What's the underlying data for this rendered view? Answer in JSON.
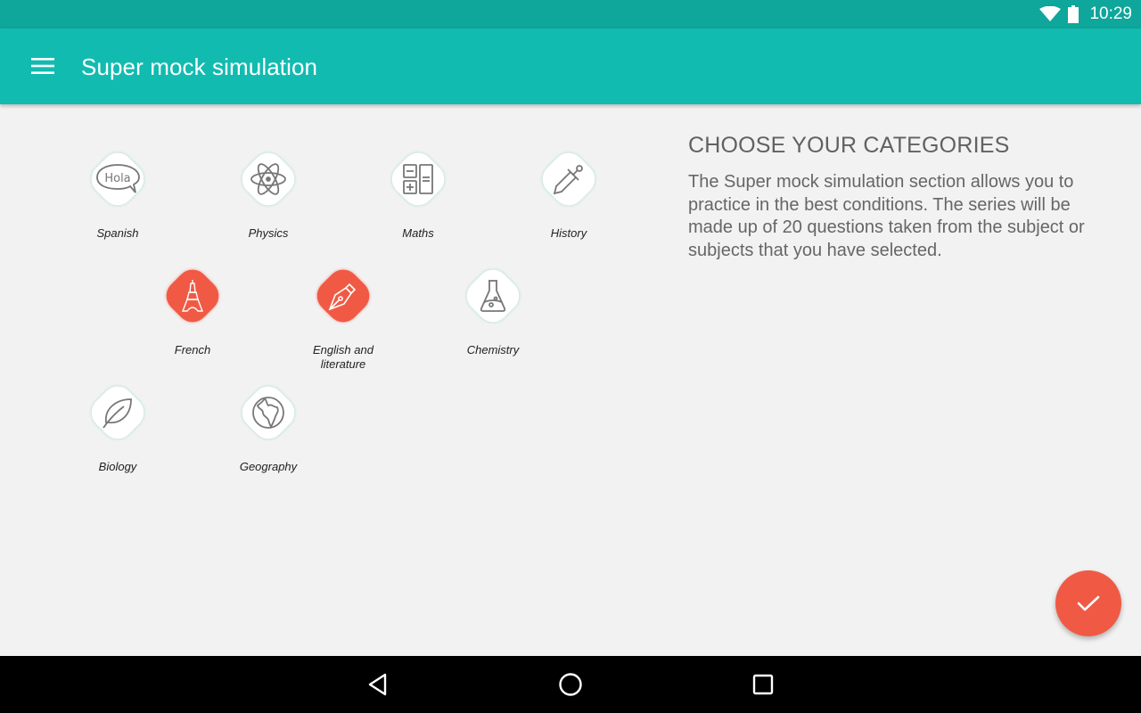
{
  "status_bar": {
    "time": "10:29",
    "icons": [
      "wifi-icon",
      "battery-icon"
    ]
  },
  "app_bar": {
    "menu_icon": "hamburger-menu-icon",
    "title": "Super mock simulation",
    "color": "#12bbb0"
  },
  "categories": [
    {
      "label": "Spanish",
      "icon": "hola-speech-bubble-icon",
      "selected": false
    },
    {
      "label": "Physics",
      "icon": "atom-icon",
      "selected": false
    },
    {
      "label": "Maths",
      "icon": "calculator-icon",
      "selected": false
    },
    {
      "label": "History",
      "icon": "sword-icon",
      "selected": false
    },
    {
      "label": "French",
      "icon": "eiffel-tower-icon",
      "selected": true
    },
    {
      "label": "English and literature",
      "icon": "fountain-pen-icon",
      "selected": true
    },
    {
      "label": "Chemistry",
      "icon": "flask-icon",
      "selected": false
    },
    {
      "label": "Biology",
      "icon": "leaf-icon",
      "selected": false
    },
    {
      "label": "Geography",
      "icon": "globe-icon",
      "selected": false
    }
  ],
  "info": {
    "title": "CHOOSE YOUR CATEGORIES",
    "text": "The Super mock simulation section allows you to practice in the best conditions. The series will be made up of 20 questions taken from the subject or subjects that you have selected."
  },
  "fab": {
    "icon": "check-icon",
    "color": "#f05a45"
  },
  "nav_bar": {
    "back": "back-icon",
    "home": "home-icon",
    "recents": "recents-icon"
  }
}
